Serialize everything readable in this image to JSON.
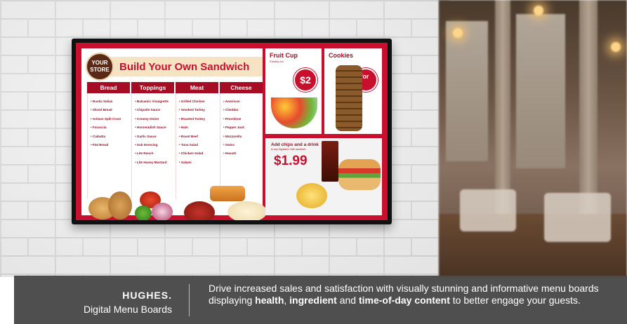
{
  "menu": {
    "logo_line1": "YOUR",
    "logo_line2": "STORE",
    "title": "Build Your Own Sandwich",
    "columns": [
      {
        "heading": "Bread",
        "items": [
          "Rustic Italian",
          "Sliced Bread",
          "Artisan Split Crust",
          "Focaccia",
          "Ciabatta",
          "Flat Bread"
        ]
      },
      {
        "heading": "Toppings",
        "items": [
          "Balsamic Vinaigrette",
          "Chipotle Sauce",
          "Creamy Onion",
          "Horseradish Sauce",
          "Garlic Sauce",
          "Sub Dressing",
          "Lite Ranch",
          "Lite Honey Mustard"
        ]
      },
      {
        "heading": "Meat",
        "items": [
          "Grilled Chicken",
          "Smoked Turkey",
          "Roasted Turkey",
          "Ham",
          "Roast Beef",
          "Tuna Salad",
          "Chicken Salad",
          "Salami"
        ]
      },
      {
        "heading": "Cheese",
        "items": [
          "American",
          "Cheddar",
          "Provolone",
          "Pepper Jack",
          "Mozzarella",
          "Swiss",
          "Havarti"
        ]
      }
    ],
    "fruit_cup": {
      "title": "Fruit Cup",
      "subtitle": "Freshly cut",
      "price": "$2"
    },
    "cookies": {
      "title": "Cookies",
      "price": "2 for $1"
    },
    "combo": {
      "title": "Add chips and a drink",
      "subtitle": "to any Signature Cafe sandwich",
      "price": "$1.99"
    }
  },
  "caption": {
    "brand_logo": "HUGHES.",
    "brand_subtitle": "Digital Menu Boards",
    "tagline_part1": "Drive increased sales and satisfaction with visually stunning and informative menu boards displaying ",
    "tagline_bold1": "health",
    "tagline_sep": ", ",
    "tagline_bold2": "ingredient",
    "tagline_part2": " and ",
    "tagline_bold3": "time-of-day content",
    "tagline_part3": " to better engage your guests."
  },
  "colors": {
    "menu_red": "#c8102e",
    "menu_dark_red": "#a50d24",
    "band": "#484848"
  }
}
